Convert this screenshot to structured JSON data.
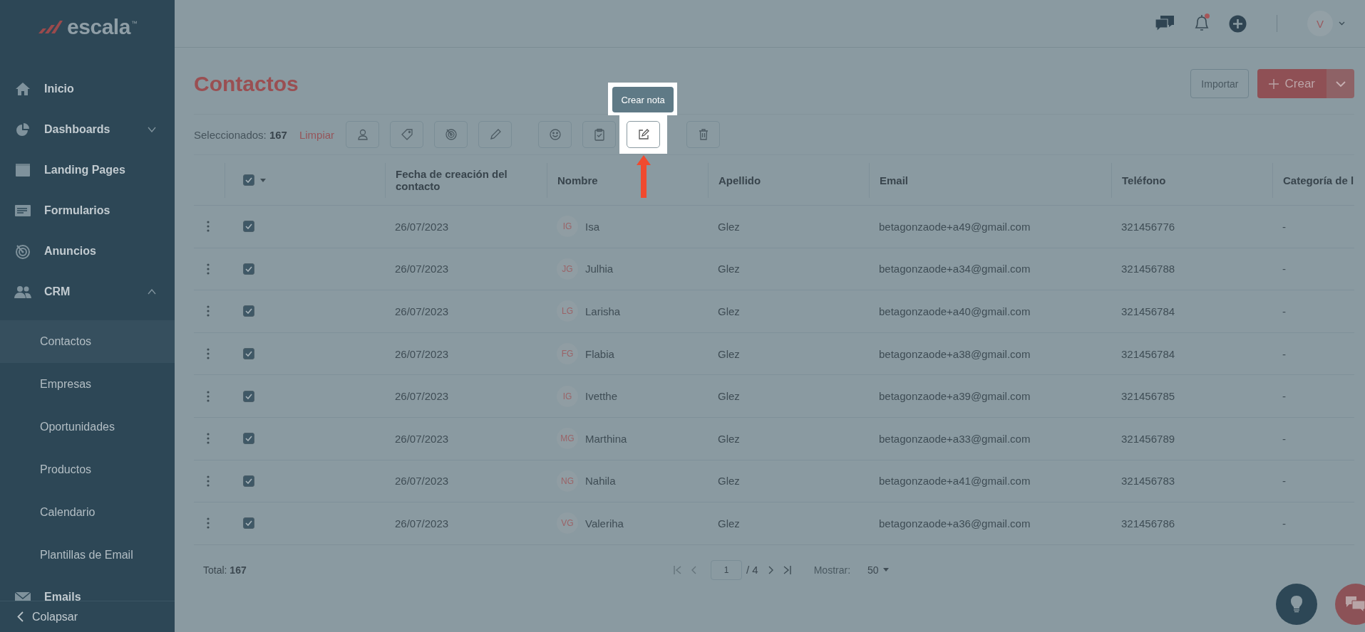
{
  "logo": {
    "text": "escala",
    "mark": "™"
  },
  "sidebar": {
    "items": [
      {
        "label": "Inicio",
        "kind": "home"
      },
      {
        "label": "Dashboards",
        "kind": "pie",
        "expanded": false
      },
      {
        "label": "Landing Pages",
        "kind": "window"
      },
      {
        "label": "Formularios",
        "kind": "form"
      },
      {
        "label": "Anuncios",
        "kind": "target"
      },
      {
        "label": "CRM",
        "kind": "people",
        "expanded": true,
        "children": [
          {
            "label": "Contactos",
            "selected": true
          },
          {
            "label": "Empresas",
            "selected": false
          },
          {
            "label": "Oportunidades",
            "selected": false
          },
          {
            "label": "Productos",
            "selected": false
          },
          {
            "label": "Calendario",
            "selected": false
          },
          {
            "label": "Plantillas de Email",
            "selected": false
          }
        ]
      },
      {
        "label": "Emails",
        "kind": "mail"
      }
    ],
    "collapse": "Colapsar"
  },
  "topbar": {
    "notification": true,
    "avatar": "V"
  },
  "page": {
    "title": "Contactos",
    "import_button": "Importar",
    "create_button": "Crear"
  },
  "selection": {
    "label": "Seleccionados:",
    "count": "167",
    "clear": "Limpiar",
    "actions": [
      {
        "kind": "user",
        "highlighted": false
      },
      {
        "kind": "tag",
        "highlighted": false
      },
      {
        "kind": "target",
        "highlighted": false
      },
      {
        "kind": "pencil",
        "highlighted": false
      },
      {
        "kind": "smile",
        "highlighted": false
      },
      {
        "kind": "clipboard",
        "highlighted": false
      },
      {
        "kind": "note",
        "highlighted": true,
        "tooltip": "Crear nota"
      },
      {
        "kind": "trash",
        "highlighted": false
      }
    ]
  },
  "table": {
    "header_checked": true,
    "columns": [
      "Fecha de creación del contacto",
      "Nombre",
      "Apellido",
      "Email",
      "Teléfono",
      "Categoría de l"
    ],
    "rows": [
      {
        "checked": true,
        "date": "26/07/2023",
        "initials": "IG",
        "name": "Isa",
        "surname": "Glez",
        "email": "betagonzaode+a49@gmail.com",
        "phone": "321456776",
        "category": "-"
      },
      {
        "checked": true,
        "date": "26/07/2023",
        "initials": "JG",
        "name": "Julhia",
        "surname": "Glez",
        "email": "betagonzaode+a34@gmail.com",
        "phone": "321456788",
        "category": "-"
      },
      {
        "checked": true,
        "date": "26/07/2023",
        "initials": "LG",
        "name": "Larisha",
        "surname": "Glez",
        "email": "betagonzaode+a40@gmail.com",
        "phone": "321456784",
        "category": "-"
      },
      {
        "checked": true,
        "date": "26/07/2023",
        "initials": "FG",
        "name": "Flabia",
        "surname": "Glez",
        "email": "betagonzaode+a38@gmail.com",
        "phone": "321456784",
        "category": "-"
      },
      {
        "checked": true,
        "date": "26/07/2023",
        "initials": "IG",
        "name": "Ivetthe",
        "surname": "Glez",
        "email": "betagonzaode+a39@gmail.com",
        "phone": "321456785",
        "category": "-"
      },
      {
        "checked": true,
        "date": "26/07/2023",
        "initials": "MG",
        "name": "Marthina",
        "surname": "Glez",
        "email": "betagonzaode+a33@gmail.com",
        "phone": "321456789",
        "category": "-"
      },
      {
        "checked": true,
        "date": "26/07/2023",
        "initials": "NG",
        "name": "Nahila",
        "surname": "Glez",
        "email": "betagonzaode+a41@gmail.com",
        "phone": "321456783",
        "category": "-"
      },
      {
        "checked": true,
        "date": "26/07/2023",
        "initials": "VG",
        "name": "Valeriha",
        "surname": "Glez",
        "email": "betagonzaode+a36@gmail.com",
        "phone": "321456786",
        "category": "-"
      }
    ]
  },
  "footer": {
    "total_label": "Total:",
    "total": "167",
    "pagination": {
      "first_disabled": true,
      "prev_disabled": true,
      "next_disabled": false,
      "last_disabled": false,
      "page": "1",
      "of": "/ 4"
    },
    "show_label": "Mostrar:",
    "show_value": "50"
  }
}
